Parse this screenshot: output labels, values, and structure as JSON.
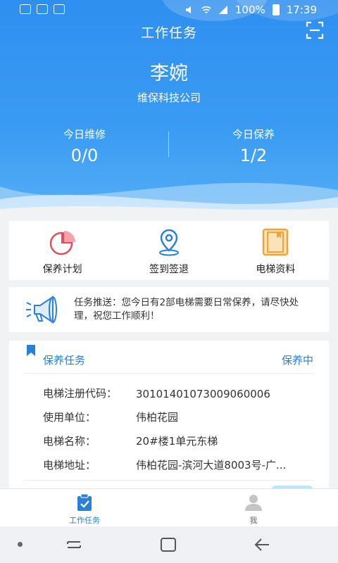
{
  "status_bar": {
    "battery": "100%",
    "time": "17:39"
  },
  "header": {
    "title": "工作任务",
    "user_name": "李婉",
    "company": "维保科技公司"
  },
  "stats": [
    {
      "label": "今日维修",
      "value": "0/0"
    },
    {
      "label": "今日保养",
      "value": "1/2"
    }
  ],
  "quick_actions": [
    {
      "label": "保养计划",
      "icon": "pie-chart-icon"
    },
    {
      "label": "签到签退",
      "icon": "location-pin-icon"
    },
    {
      "label": "电梯资料",
      "icon": "folder-icon"
    }
  ],
  "notice": {
    "text": "任务推送：您今日有2部电梯需要日常保养，请尽快处理，祝您工作顺利！",
    "icon": "megaphone-icon"
  },
  "task_card": {
    "title": "保养任务",
    "status": "保养中",
    "rows": [
      {
        "key": "电梯注册代码：",
        "value": "30101401073009060006"
      },
      {
        "key": "使用单位：",
        "value": "伟柏花园"
      },
      {
        "key": "电梯名称：",
        "value": "20#楼1单元东梯"
      },
      {
        "key": "电梯地址：",
        "value": "伟柏花园-滨河大道8003号-广..."
      }
    ]
  },
  "tabs": [
    {
      "label": "工作任务",
      "icon": "clipboard-check-icon",
      "active": true
    },
    {
      "label": "我",
      "icon": "user-icon",
      "active": false
    }
  ],
  "colors": {
    "primary": "#2f8ff0",
    "accent": "#2a7fd6",
    "pie_red": "#e34c5c",
    "folder_orange": "#f2a43a"
  }
}
